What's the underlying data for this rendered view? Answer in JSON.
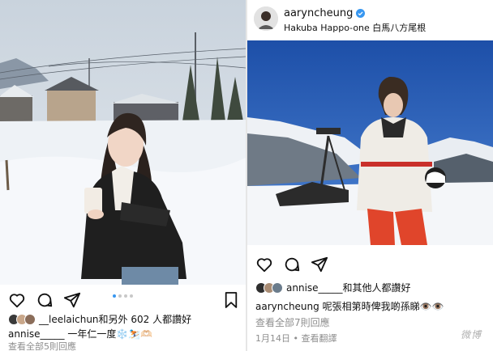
{
  "left_post": {
    "carousel_dots": 4,
    "carousel_active": 0,
    "likes": {
      "user": "__leelaichun",
      "text": "和另外 602 人都讚好"
    },
    "caption": {
      "user": "annise_____",
      "text": "一年仁一度❄️⛷️🫶🏻"
    },
    "comments_link": "查看全部5則回應"
  },
  "right_post": {
    "username": "aaryncheung",
    "location": "Hakuba Happo-one 白馬八方尾根",
    "likes": {
      "user": "annise_____",
      "text": "和其他人都讚好"
    },
    "caption": {
      "user": "aaryncheung",
      "text": "呢張相第時俾我啲孫睇👁️👁️"
    },
    "comments_link": "查看全部7則回應",
    "date": "1月14日",
    "translate": "查看翻譯"
  },
  "icons": {
    "like": "heart-icon",
    "comment": "comment-icon",
    "share": "share-icon",
    "save": "bookmark-icon",
    "verified": "verified-badge-icon"
  },
  "colors": {
    "verified": "#3897f0",
    "active_dot": "#3897f0",
    "muted": "#8e8e8e"
  },
  "watermark": "微博"
}
